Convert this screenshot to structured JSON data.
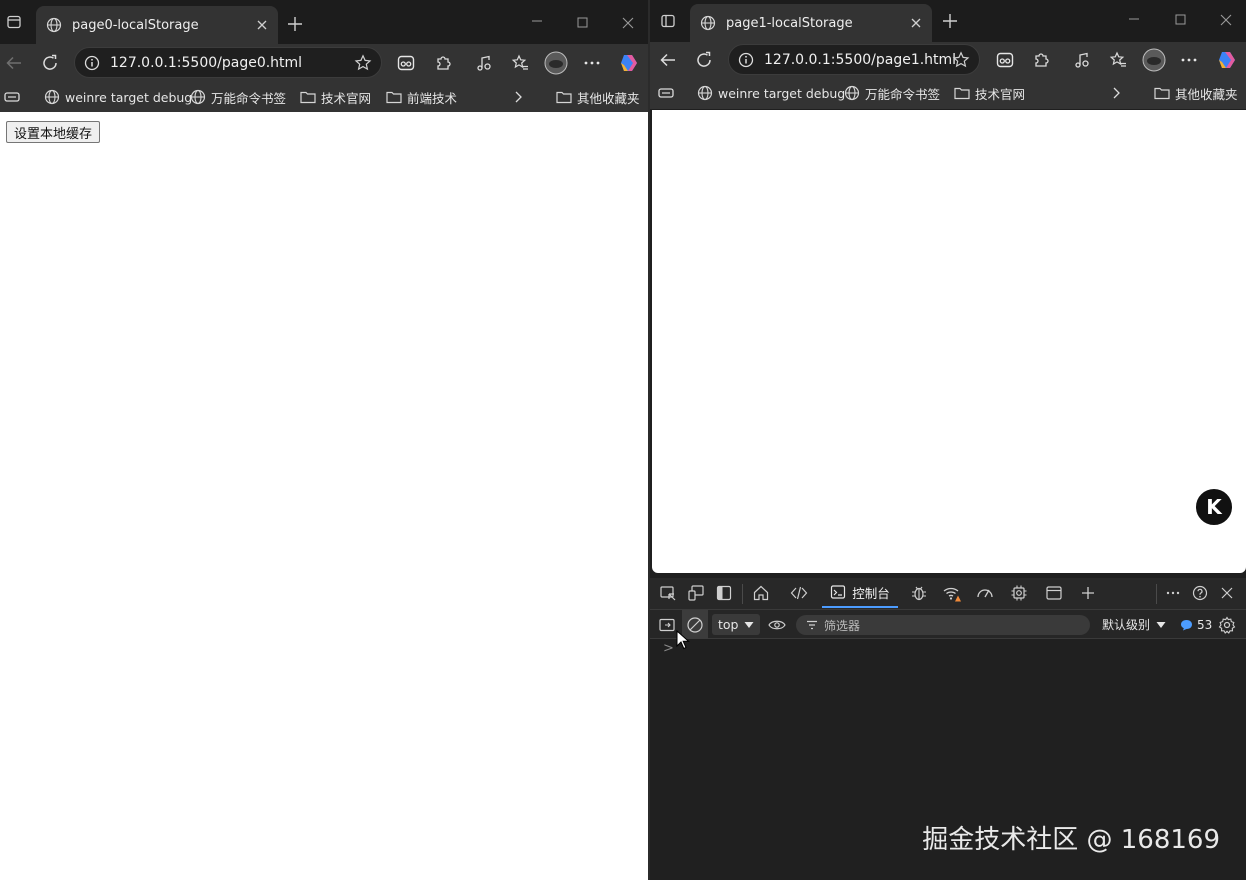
{
  "left_window": {
    "tab_title": "page0-localStorage",
    "address": "127.0.0.1:5500/page0.html",
    "bookmarks": [
      {
        "label": "weinre target debug",
        "icon": "globe-icon"
      },
      {
        "label": "万能命令书签",
        "icon": "globe-icon"
      },
      {
        "label": "技术官网",
        "icon": "folder-icon"
      },
      {
        "label": "前端技术",
        "icon": "folder-icon"
      }
    ],
    "other_bookmarks": "其他收藏夹",
    "page_button": "设置本地缓存"
  },
  "right_window": {
    "tab_title": "page1-localStorage",
    "address": "127.0.0.1:5500/page1.html",
    "bookmarks": [
      {
        "label": "weinre target debug",
        "icon": "globe-icon"
      },
      {
        "label": "万能命令书签",
        "icon": "globe-icon"
      },
      {
        "label": "技术官网",
        "icon": "folder-icon"
      }
    ],
    "other_bookmarks": "其他收藏夹",
    "fab_letter": "K",
    "devtools": {
      "active_tab": "控制台",
      "context": "top",
      "filter_placeholder": "筛选器",
      "level": "默认级别",
      "message_count": "53",
      "prompt": ">"
    }
  },
  "watermark": "掘金技术社区 @ 168169",
  "colors": {
    "chrome": "#333333",
    "tabbar": "#1c1c1c",
    "devtools_bg": "#202020",
    "accent": "#4c9cff"
  }
}
